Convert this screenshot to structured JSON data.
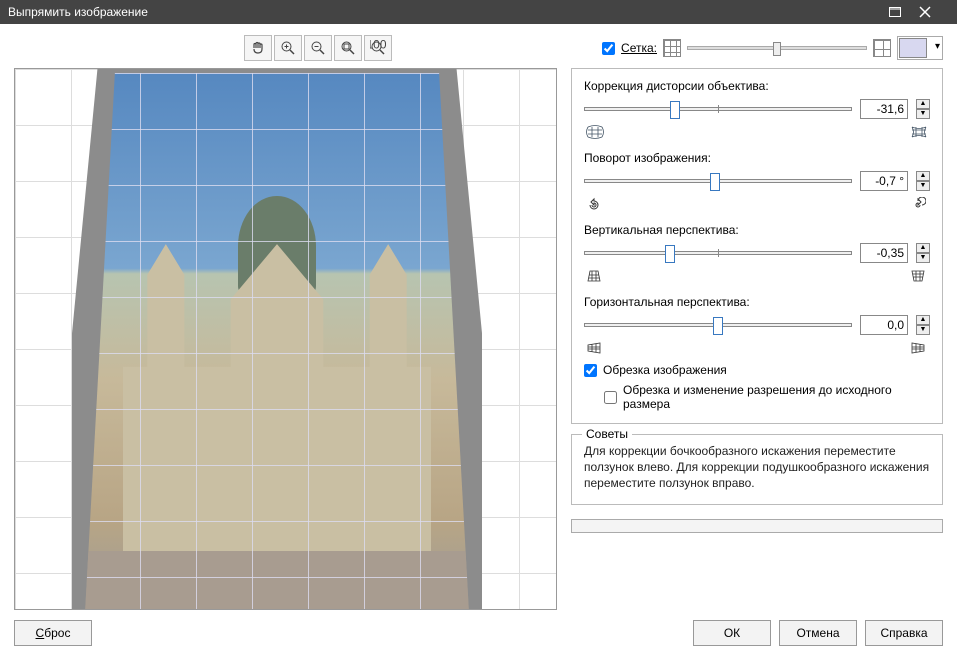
{
  "window": {
    "title": "Выпрямить изображение"
  },
  "toolbar": {
    "pan": "pan-tool",
    "zoom_in": "zoom-in",
    "zoom_out": "zoom-out",
    "fit": "fit-window",
    "actual": "100%"
  },
  "grid": {
    "label": "Сетка:",
    "checked": true,
    "color": "#d8d8f0"
  },
  "controls": {
    "lens": {
      "label": "Коррекция дисторсии объектива:",
      "value": "-31,6",
      "pos": 34
    },
    "rotate": {
      "label": "Поворот изображения:",
      "value": "-0,7 °",
      "pos": 49
    },
    "vpersp": {
      "label": "Вертикальная перспектива:",
      "value": "-0,35",
      "pos": 32
    },
    "hpersp": {
      "label": "Горизонтальная перспектива:",
      "value": "0,0",
      "pos": 50
    },
    "crop": {
      "label": "Обрезка изображения",
      "checked": true
    },
    "crop_resize": {
      "label": "Обрезка и изменение разрешения до исходного размера",
      "checked": false
    }
  },
  "tips": {
    "legend": "Советы",
    "text": "Для коррекции бочкообразного искажения переместите ползунок влево. Для коррекции подушкообразного искажения переместите ползунок вправо."
  },
  "buttons": {
    "reset": "Сброс",
    "ok": "ОК",
    "cancel": "Отмена",
    "help": "Справка"
  }
}
